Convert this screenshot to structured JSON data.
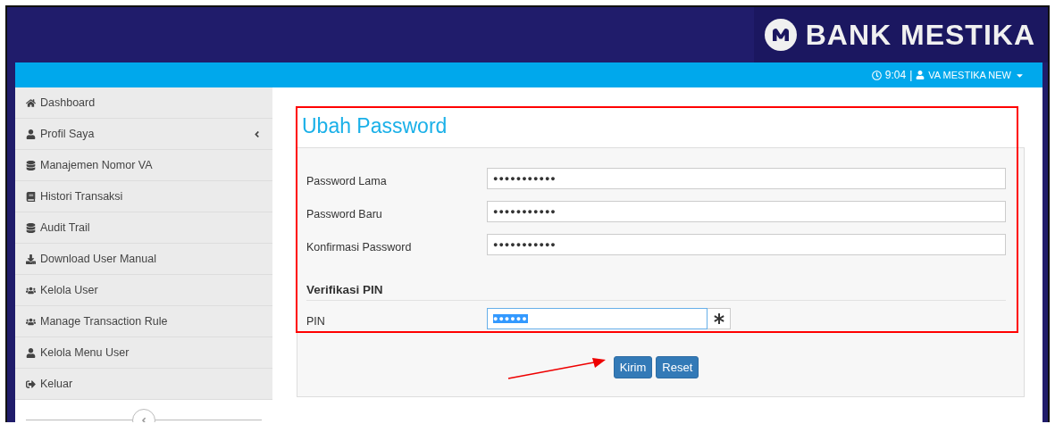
{
  "header": {
    "brand": "BANK MESTIKA"
  },
  "topbar": {
    "time": "9:04",
    "separator": "|",
    "user": "VA MESTIKA NEW"
  },
  "sidebar": {
    "items": [
      {
        "label": "Dashboard",
        "selected": false
      },
      {
        "label": "Profil Saya",
        "selected": false,
        "expanded": false
      },
      {
        "label": "Manajemen Nomor VA",
        "selected": false
      },
      {
        "label": "Histori Transaksi",
        "selected": false
      },
      {
        "label": "Audit Trail",
        "selected": false
      },
      {
        "label": "Download User Manual",
        "selected": false
      },
      {
        "label": "Kelola User",
        "selected": false
      },
      {
        "label": "Manage Transaction Rule",
        "selected": false
      },
      {
        "label": "Kelola Menu User",
        "selected": false
      },
      {
        "label": "Keluar",
        "selected": false
      }
    ]
  },
  "form": {
    "title": "Ubah Password",
    "fields": [
      {
        "label": "Password Lama",
        "value": "●●●●●●●●●●●"
      },
      {
        "label": "Password Baru",
        "value": "●●●●●●●●●●●"
      },
      {
        "label": "Konfirmasi Password",
        "value": "●●●●●●●●●●●"
      }
    ],
    "pin_section": {
      "title": "Verifikasi PIN",
      "label": "PIN",
      "value": "●●●●●●",
      "text_selected": true
    },
    "buttons": [
      "Kirim",
      "Reset"
    ]
  }
}
